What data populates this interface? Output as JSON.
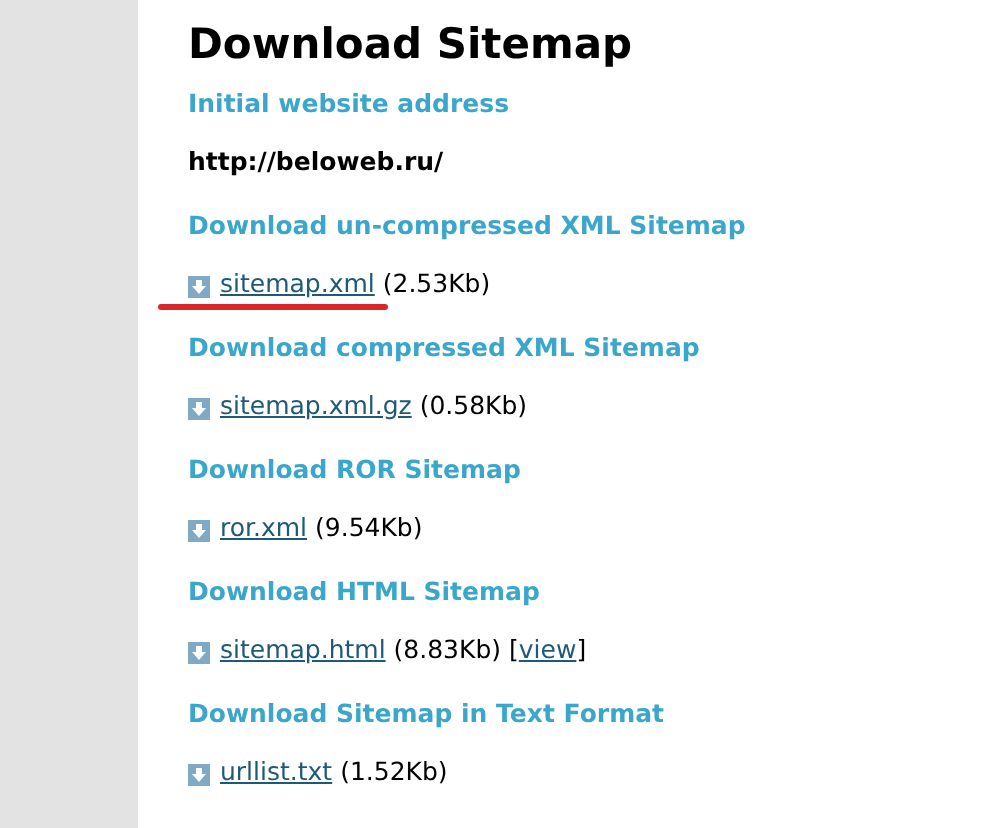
{
  "title": "Download Sitemap",
  "sections": [
    {
      "heading": "Initial website address",
      "kind": "text",
      "value": "http://beloweb.ru/"
    },
    {
      "heading": "Download un-compressed XML Sitemap",
      "kind": "file",
      "file": "sitemap.xml",
      "size": "(2.53Kb)",
      "marked": true
    },
    {
      "heading": "Download compressed XML Sitemap",
      "kind": "file",
      "file": "sitemap.xml.gz",
      "size": "(0.58Kb)",
      "marked": false
    },
    {
      "heading": "Download ROR Sitemap",
      "kind": "file",
      "file": "ror.xml",
      "size": "(9.54Kb)",
      "marked": false
    },
    {
      "heading": "Download HTML Sitemap",
      "kind": "file",
      "file": "sitemap.html",
      "size": "(8.83Kb)",
      "marked": false,
      "view": {
        "open": "[",
        "label": "view",
        "close": "]"
      }
    },
    {
      "heading": "Download Sitemap in Text Format",
      "kind": "file",
      "file": "urllist.txt",
      "size": "(1.52Kb)",
      "marked": false
    }
  ]
}
